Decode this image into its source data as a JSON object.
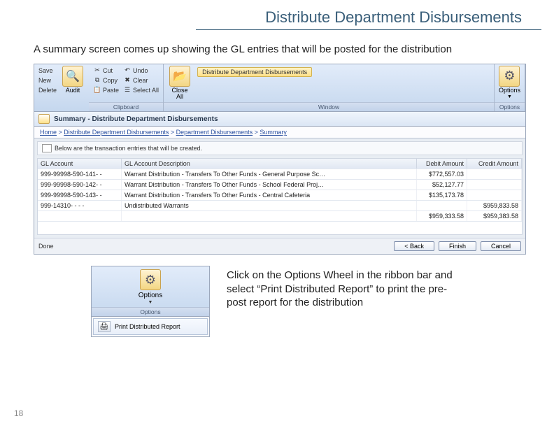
{
  "page": {
    "title": "Distribute Department Disbursements",
    "number": "18"
  },
  "instruction_top": "A summary screen comes up showing the GL entries that will be posted for the distribution",
  "ribbon": {
    "file": {
      "save": "Save",
      "new": "New",
      "delete": "Delete",
      "audit": "Audit"
    },
    "clipboard": {
      "cut": "Cut",
      "copy": "Copy",
      "paste": "Paste",
      "undo": "Undo",
      "clear": "Clear",
      "selectall": "Select All",
      "group": "Clipboard"
    },
    "window": {
      "closeall": "Close\nAll",
      "tab": "Distribute Department Disbursements",
      "group": "Window"
    },
    "options": {
      "label": "Options",
      "group": "Options"
    }
  },
  "titlebar": "Summary - Distribute Department Disbursements",
  "breadcrumb": {
    "a": "Home",
    "b": "Distribute Department Disbursements",
    "c": "Department Disbursements",
    "d": "Summary"
  },
  "notice": "Below are the transaction entries that will be created.",
  "table": {
    "headers": {
      "acct": "GL Account",
      "desc": "GL Account Description",
      "debit": "Debit Amount",
      "credit": "Credit Amount"
    },
    "rows": [
      {
        "acct": "999-99998-590-141- -",
        "desc": "Warrant Distribution - Transfers To Other Funds - General Purpose Sc…",
        "debit": "$772,557.03",
        "credit": ""
      },
      {
        "acct": "999-99998-590-142- -",
        "desc": "Warrant Distribution - Transfers To Other Funds - School Federal Proj…",
        "debit": "$52,127.77",
        "credit": ""
      },
      {
        "acct": "999-99998-590-143- -",
        "desc": "Warrant Distribution - Transfers To Other Funds - Central Cafeteria",
        "debit": "$135,173.78",
        "credit": ""
      },
      {
        "acct": "999-14310- - - -",
        "desc": "Undistributed Warrants",
        "debit": "",
        "credit": "$959,833.58"
      }
    ],
    "totals": {
      "debit": "$959,333.58",
      "credit": "$959,383.58"
    }
  },
  "footer": {
    "status": "Done",
    "back": "< Back",
    "finish": "Finish",
    "cancel": "Cancel"
  },
  "options_snip": {
    "label": "Options",
    "group": "Options",
    "menu_item": "Print Distributed Report"
  },
  "instruction_bottom": "Click on the Options Wheel in the ribbon bar and select “Print Distributed Report” to print the pre-post report for the distribution"
}
